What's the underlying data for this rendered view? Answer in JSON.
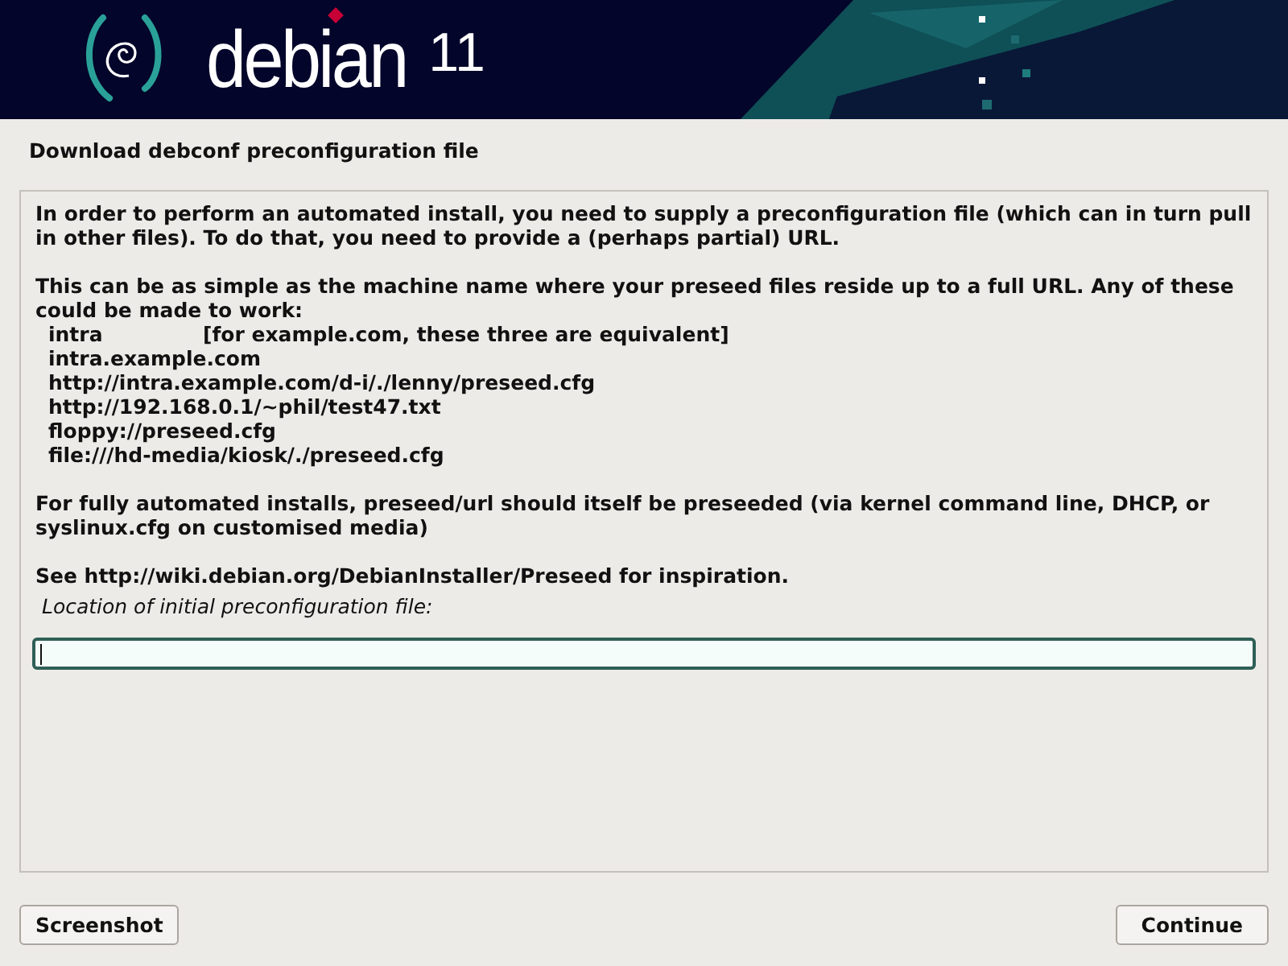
{
  "banner": {
    "brand": "debian",
    "version": "11"
  },
  "page_title": "Download debconf preconfiguration file",
  "description": [
    {
      "kind": "paragraph",
      "text": "In order to perform an automated install, you need to supply a preconfiguration file (which can in turn pull in other files). To do that, you need to provide a (perhaps partial) URL."
    },
    {
      "kind": "paragraph",
      "text": "This can be as simple as the machine name where your preseed files reside up to a full URL. Any of these could be made to work:",
      "examples": [
        {
          "value": "intra",
          "note": "[for example.com, these three are equivalent]"
        },
        {
          "value": "intra.example.com"
        },
        {
          "value": "http://intra.example.com/d-i/./lenny/preseed.cfg"
        },
        {
          "value": "http://192.168.0.1/~phil/test47.txt"
        },
        {
          "value": "floppy://preseed.cfg"
        },
        {
          "value": "file:///hd-media/kiosk/./preseed.cfg"
        }
      ]
    },
    {
      "kind": "paragraph",
      "text": "For fully automated installs, preseed/url should itself be preseeded (via kernel command line, DHCP, or syslinux.cfg on customised media)"
    },
    {
      "kind": "paragraph",
      "text": "See http://wiki.debian.org/DebianInstaller/Preseed for inspiration."
    }
  ],
  "field": {
    "label": "Location of initial preconfiguration file:"
  },
  "buttons": {
    "left": "Screenshot",
    "right": "Continue"
  }
}
